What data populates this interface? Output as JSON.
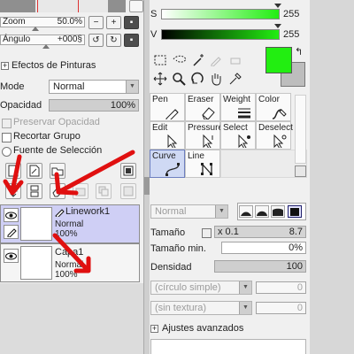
{
  "navigator": {
    "zoom_label": "Zoom",
    "zoom_value": "50.0%",
    "angle_label": "Ángulo",
    "angle_value": "+000§"
  },
  "layer_panel": {
    "paint_effects_label": "Efectos de Pinturas",
    "mode_label": "Mode",
    "mode_value": "Normal",
    "opacity_label": "Opacidad",
    "opacity_value": "100%",
    "preserve_opacity_label": "Preservar Opacidad",
    "clip_group_label": "Recortar Grupo",
    "selection_source_label": "Fuente de Selección",
    "layers": [
      {
        "name": "Linework1",
        "mode": "Normal",
        "opacity": "100%",
        "selected": true
      },
      {
        "name": "Capa1",
        "mode": "Normal",
        "opacity": "100%",
        "selected": false
      }
    ]
  },
  "color_panel": {
    "s_label": "S",
    "s_value": "255",
    "v_label": "V",
    "v_value": "255",
    "primary_color": "#22ee11",
    "secondary_color": "#bdbdbd"
  },
  "tool_grid": [
    {
      "label": "Pen",
      "icon": "pen-icon",
      "selected": false
    },
    {
      "label": "Eraser",
      "icon": "eraser-icon",
      "selected": false
    },
    {
      "label": "Weight",
      "icon": "weight-icon",
      "selected": false
    },
    {
      "label": "Color",
      "icon": "color-icon",
      "selected": false
    },
    {
      "label": "Edit",
      "icon": "edit-icon",
      "selected": false
    },
    {
      "label": "Pressure",
      "icon": "pressure-icon",
      "selected": false
    },
    {
      "label": "Select",
      "icon": "select-icon",
      "selected": false
    },
    {
      "label": "Deselect",
      "icon": "deselect-icon",
      "selected": false
    },
    {
      "label": "Curve",
      "icon": "curve-icon",
      "selected": true
    },
    {
      "label": "Line",
      "icon": "line-icon",
      "selected": false
    }
  ],
  "brush_panel": {
    "blend_mode": "Normal",
    "size_label": "Tamaño",
    "size_multiplier": "x 0.1",
    "size_value": "8.7",
    "min_size_label": "Tamaño min.",
    "min_size_value": "0%",
    "density_label": "Densidad",
    "density_value": "100",
    "brush_shape": "(círculo simple)",
    "brush_shape_value": "0",
    "texture": "(sin textura)",
    "texture_value": "0",
    "advanced_label": "Ajustes avanzados"
  },
  "annotation_color": "#e01010"
}
